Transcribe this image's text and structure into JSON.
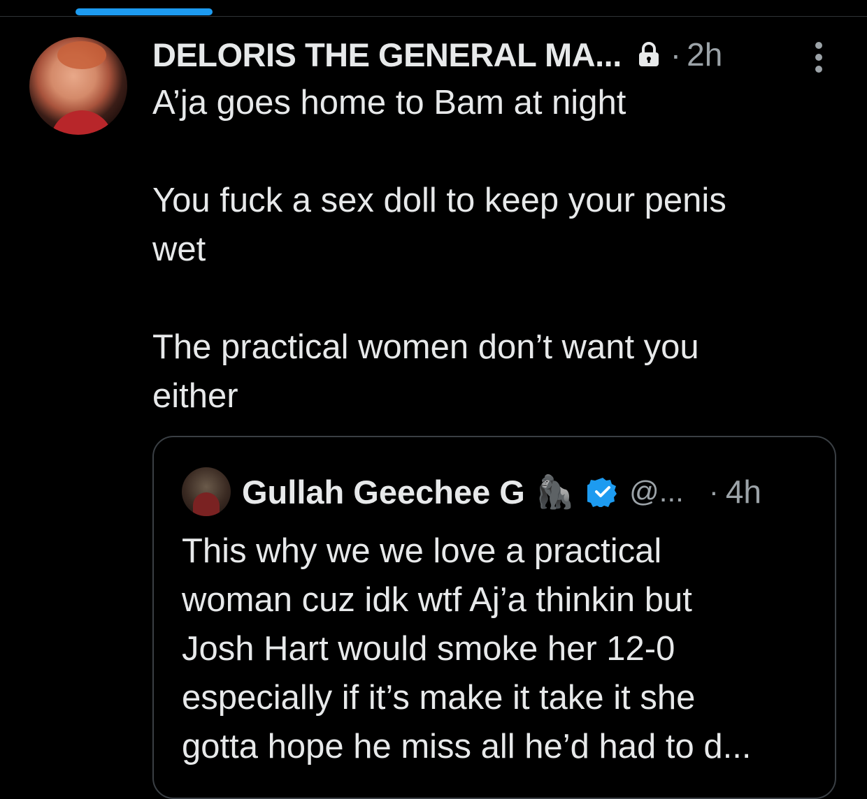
{
  "post": {
    "author_name": "DELORIS THE GENERAL MA...",
    "separator": "·",
    "time": "2h",
    "lines": [
      "A’ja goes home to Bam at night",
      "",
      "You fuck a sex doll to keep your penis",
      "wet",
      "",
      "The practical women don’t want you",
      "either"
    ]
  },
  "quote": {
    "author_name": "Gullah Geechee G",
    "emoji": "🦍",
    "handle": "@...",
    "separator": "·",
    "time": "4h",
    "lines": [
      "This why we we love a practical",
      "woman cuz idk wtf Aj’a thinkin but",
      "Josh Hart would smoke her 12-0",
      "especially if it’s make it take it she",
      "gotta hope he miss all he’d had to d..."
    ]
  },
  "colors": {
    "background": "#000000",
    "text_primary": "#e7e9ea",
    "text_secondary": "#9ca3a8",
    "accent": "#1d9bf0",
    "border": "#3a3f44"
  },
  "icons": {
    "lock": "lock-icon",
    "more": "more-options-icon",
    "verified": "verified-badge-icon"
  }
}
